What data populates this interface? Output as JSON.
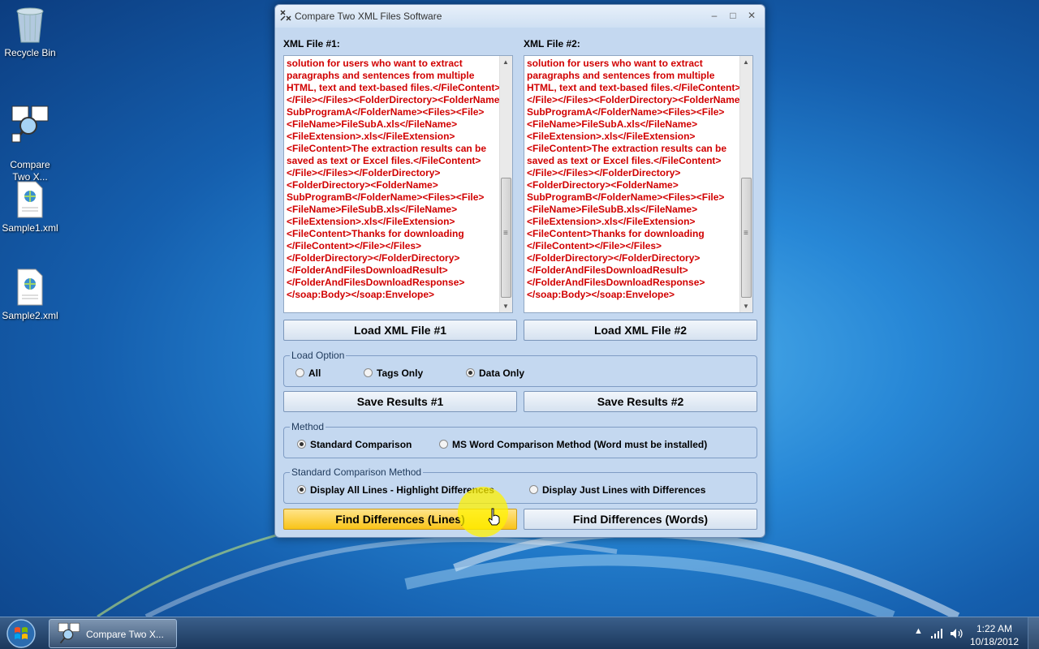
{
  "desktop": {
    "icons": [
      {
        "label": "Recycle Bin"
      },
      {
        "label": "Compare\nTwo X..."
      },
      {
        "label": "Sample1.xml"
      },
      {
        "label": "Sample2.xml"
      }
    ]
  },
  "window": {
    "title": "Compare Two XML Files Software",
    "xml1_label": "XML File #1:",
    "xml2_label": "XML File #2:",
    "xml1_content": "solution for users who want to extract\nparagraphs and sentences from multiple\nHTML, text and text-based files.</FileContent>\n</File></Files><FolderDirectory><FolderName>\nSubProgramA</FolderName><Files><File>\n<FileName>FileSubA.xls</FileName>\n<FileExtension>.xls</FileExtension>\n<FileContent>The extraction results can be\nsaved as text or Excel files.</FileContent>\n</File></Files></FolderDirectory>\n<FolderDirectory><FolderName>\nSubProgramB</FolderName><Files><File>\n<FileName>FileSubB.xls</FileName>\n<FileExtension>.xls</FileExtension>\n<FileContent>Thanks for downloading\n</FileContent></File></Files>\n</FolderDirectory></FolderDirectory>\n</FolderAndFilesDownloadResult>\n</FolderAndFilesDownloadResponse>\n</soap:Body></soap:Envelope>",
    "xml2_content": "solution for users who want to extract\nparagraphs and sentences from multiple\nHTML, text and text-based files.</FileContent></File>\n</File></Files><FolderDirectory><FolderName>\nSubProgramA</FolderName><Files><File>\n<FileName>FileSubA.xls</FileName>\n<FileExtension>.xls</FileExtension>\n<FileContent>The extraction results can be\nsaved as text or Excel files.</FileContent>\n</File></Files></FolderDirectory>\n<FolderDirectory><FolderName>\nSubProgramB</FolderName><Files><File>\n<FileName>FileSubB.xls</FileName>\n<FileExtension>.xls</FileExtension>\n<FileContent>Thanks for downloading\n</FileContent></File></Files>\n</FolderDirectory></FolderDirectory>\n</FolderAndFilesDownloadResult>\n</FolderAndFilesDownloadResponse>\n</soap:Body></soap:Envelope>",
    "load1": "Load XML File #1",
    "load2": "Load XML File #2",
    "load_option": {
      "legend": "Load Option",
      "options": [
        "All",
        "Tags Only",
        "Data Only"
      ],
      "selected": "Data Only"
    },
    "save1": "Save Results #1",
    "save2": "Save Results #2",
    "method": {
      "legend": "Method",
      "options": [
        "Standard Comparison",
        "MS Word Comparison Method (Word must be installed)"
      ],
      "selected": "Standard Comparison"
    },
    "standard_method": {
      "legend": "Standard Comparison Method",
      "options": [
        "Display All Lines - Highlight Differences",
        "Display Just Lines with Differences"
      ],
      "selected": "Display All Lines - Highlight Differences"
    },
    "find_lines": "Find Differences (Lines)",
    "find_words": "Find Differences (Words)"
  },
  "taskbar": {
    "task_label": "Compare Two X...",
    "time": "1:22 AM",
    "date": "10/18/2012"
  },
  "colors": {
    "xml_text": "#d10000",
    "active_button": "#f9c418",
    "client_bg": "#c4d8f0"
  }
}
